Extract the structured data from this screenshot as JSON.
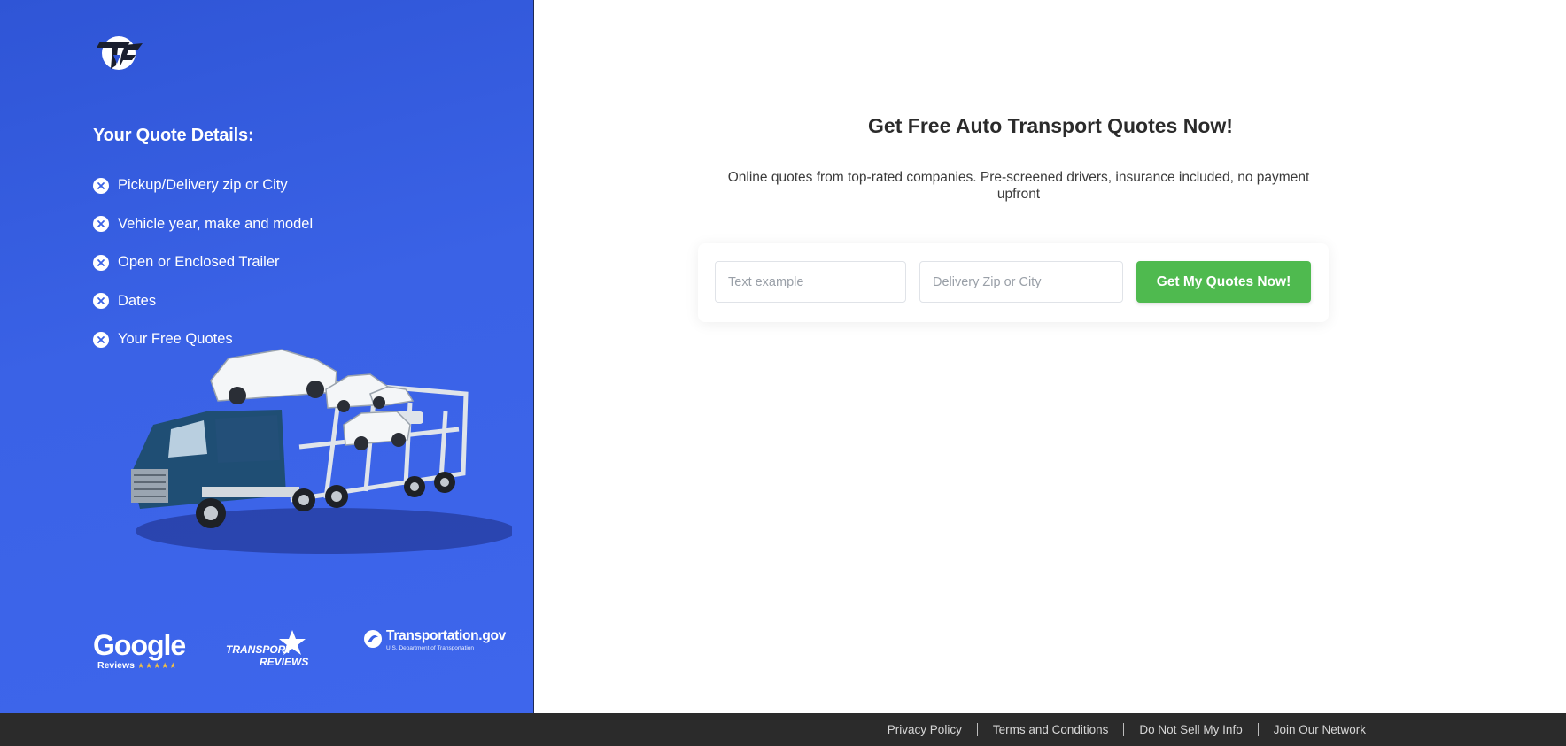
{
  "sidebar": {
    "logo": {
      "icon": "brand-logo-icon",
      "accent": "#1a1f2e"
    },
    "quote_details": {
      "title": "Your Quote Details:",
      "items": [
        {
          "label": "Pickup/Delivery zip or City",
          "icon": "x-circle-icon"
        },
        {
          "label": "Vehicle year, make and model",
          "icon": "x-circle-icon"
        },
        {
          "label": "Open or Enclosed Trailer",
          "icon": "x-circle-icon"
        },
        {
          "label": "Dates",
          "icon": "x-circle-icon"
        },
        {
          "label": "Your Free Quotes",
          "icon": "x-circle-icon"
        }
      ]
    },
    "illustration": "car-carrier-truck",
    "partners": {
      "google": {
        "name": "Google",
        "sub": "Reviews",
        "stars": "★★★★★"
      },
      "transport_reviews": {
        "line1": "TRANSPORT",
        "line2": "REVIEWS"
      },
      "dot": {
        "name": "Transportation.gov",
        "sub": "U.S. Department of Transportation"
      }
    },
    "background_color": "#3a62e6"
  },
  "main": {
    "title": "Get Free Auto Transport Quotes Now!",
    "description": "Online quotes from top-rated companies. Pre-screened drivers, insurance included, no payment upfront",
    "form": {
      "pickup": {
        "value": "",
        "placeholder": "Text example"
      },
      "delivery": {
        "value": "",
        "placeholder": "Delivery Zip or City"
      },
      "submit_label": "Get My Quotes Now!",
      "submit_color": "#4fba4f"
    }
  },
  "footer": {
    "links": [
      "Privacy Policy",
      "Terms and Conditions",
      "Do Not Sell My Info",
      "Join Our Network"
    ],
    "background_color": "#2b2b2b"
  }
}
